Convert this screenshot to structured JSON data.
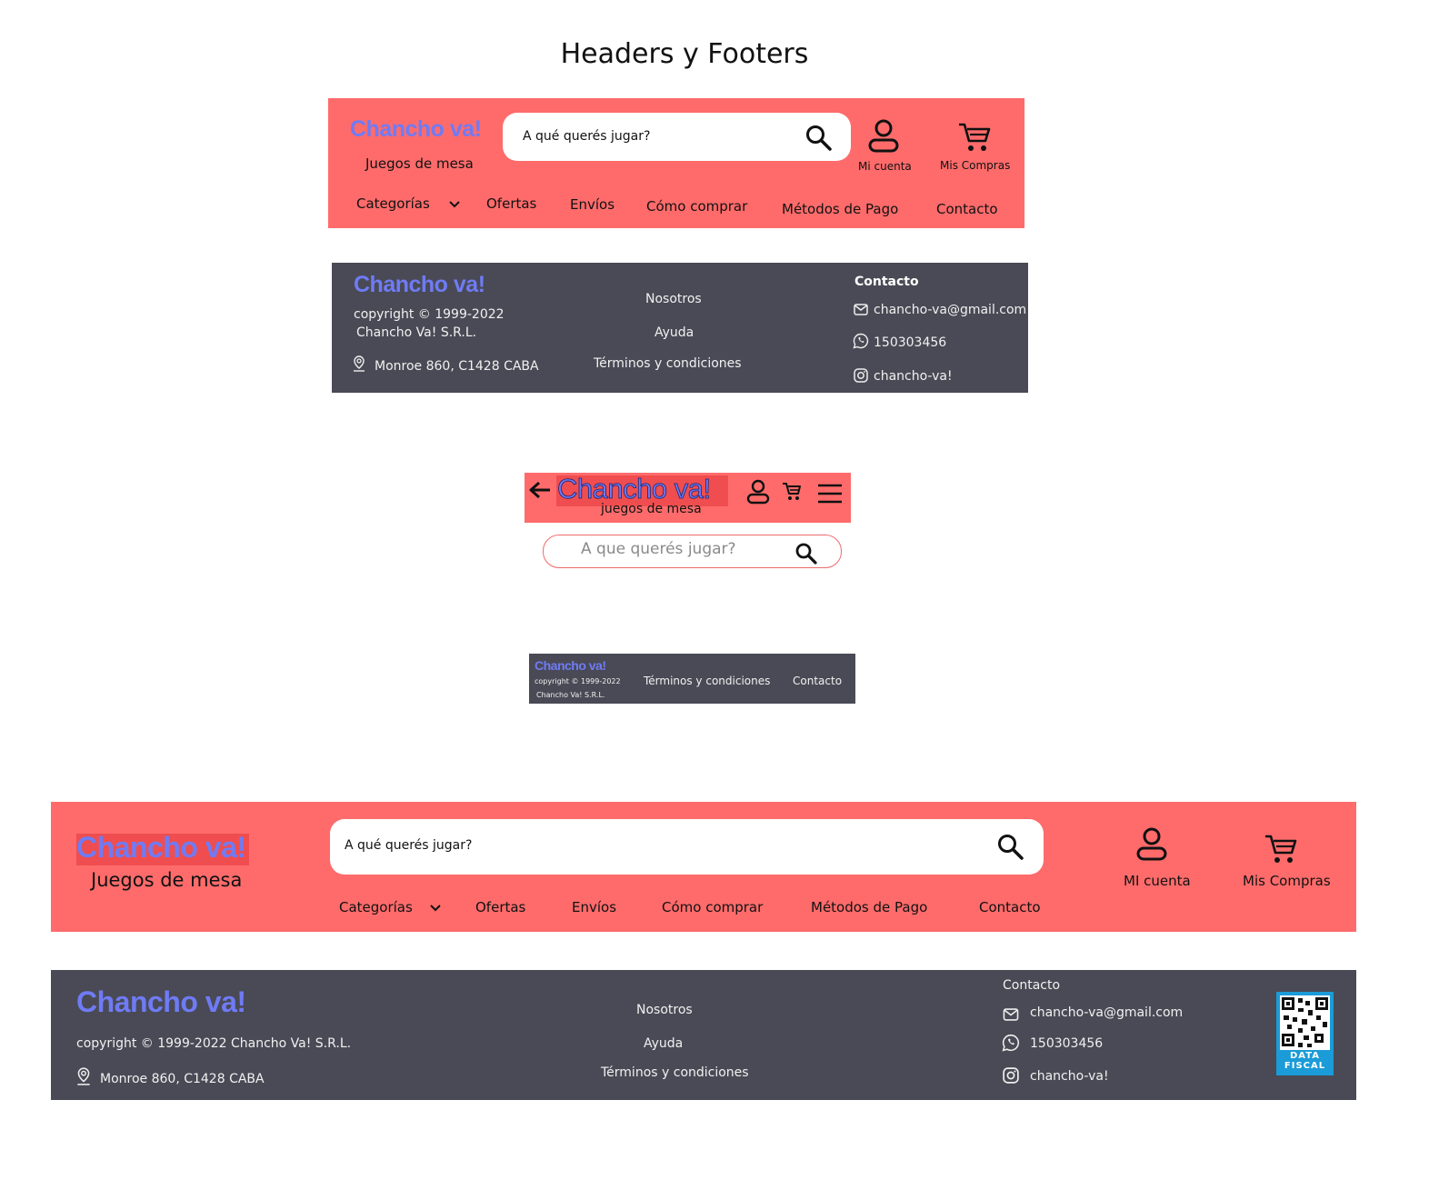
{
  "page_title": "Headers y Footers",
  "brand": {
    "logo": "Chancho va!",
    "tagline_desktop": "Juegos de mesa",
    "tagline_mobile": "juegos de mesa",
    "copyright": "copyright © 1999-2022",
    "company": "Chancho Va! S.R.L.",
    "copyright_full": "copyright © 1999-2022 Chancho Va! S.R.L.",
    "address": "Monroe 860, C1428 CABA"
  },
  "search": {
    "placeholder": "A qué querés jugar?",
    "placeholder_mobile": "A que querés jugar?"
  },
  "header": {
    "account_label": "Mi cuenta",
    "account_label_wide": "MI cuenta",
    "cart_label": "Mis Compras",
    "nav": [
      "Categorías",
      "Ofertas",
      "Envíos",
      "Cómo comprar",
      "Métodos de Pago",
      "Contacto"
    ]
  },
  "footer": {
    "links": [
      "Nosotros",
      "Ayuda",
      "Términos y condiciones"
    ],
    "contact_title": "Contacto",
    "email": "chancho-va@gmail.com",
    "phone": "150303456",
    "instagram": "chancho-va!",
    "mobile_links": [
      "Términos y condiciones",
      "Contacto"
    ],
    "qr_caption": [
      "DATA",
      "FISCAL"
    ]
  },
  "colors": {
    "header_bg": "#ff6b6b",
    "footer_bg": "#494a55",
    "logo": "#6f7bf5",
    "qr_frame": "#1b9bd7"
  }
}
